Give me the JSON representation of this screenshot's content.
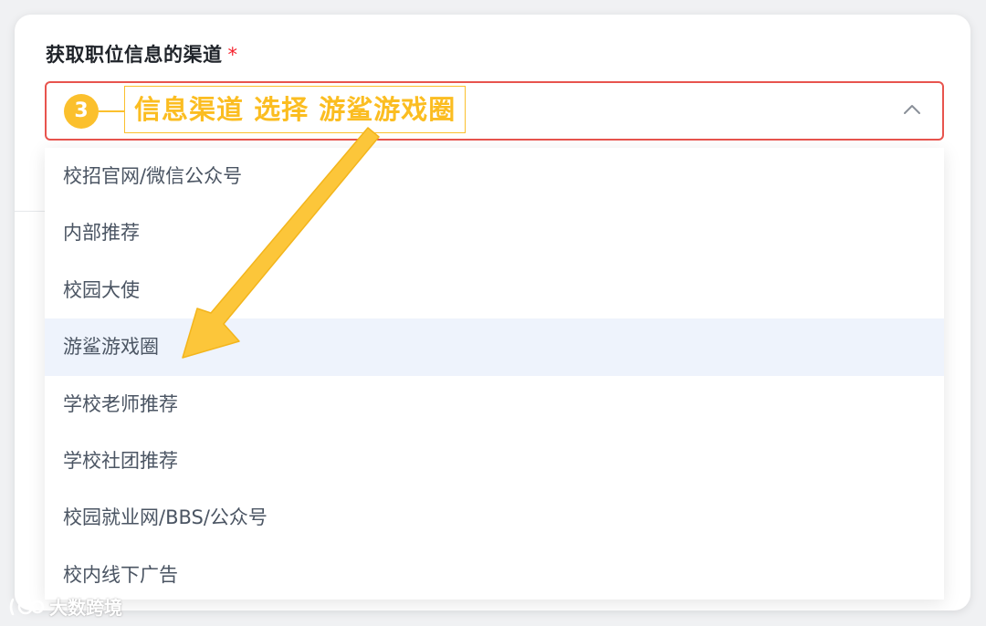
{
  "form": {
    "field_label": "获取职位信息的渠道",
    "required_mark": "*"
  },
  "dropdown": {
    "options": [
      "校招官网/微信公众号",
      "内部推荐",
      "校园大使",
      "游鲨游戏圈",
      "学校老师推荐",
      "学校社团推荐",
      "校园就业网/BBS/公众号",
      "校内线下广告"
    ],
    "highlighted_option": "游鲨游戏圈"
  },
  "annotation": {
    "step_number": "3",
    "text": "信息渠道 选择 游鲨游戏圈",
    "color": "#fbc02d"
  },
  "icons": {
    "select": "chevron-up-icon",
    "watermark": "logo-icon"
  },
  "watermark": {
    "text": "大数跨境"
  },
  "colors": {
    "error_border": "#e8544e",
    "required": "#f5222d",
    "option_highlight": "#eef3fc",
    "annotation": "#fbc02d"
  }
}
